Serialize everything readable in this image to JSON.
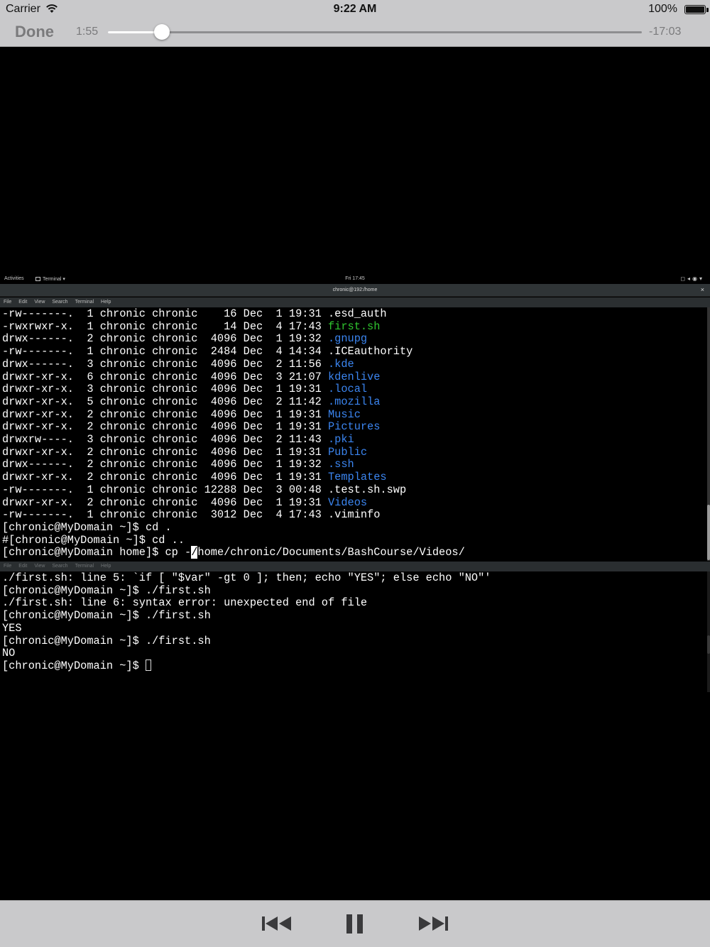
{
  "status_bar": {
    "carrier": "Carrier",
    "time": "9:22 AM",
    "battery": "100%"
  },
  "player": {
    "done_label": "Done",
    "elapsed": "1:55",
    "remaining": "-17:03",
    "progress_fraction": 0.101,
    "controls": [
      "rewind-icon",
      "pause-icon",
      "fast-forward-icon"
    ]
  },
  "desktop": {
    "activities": "Activities",
    "app_menu": "Terminal ▾",
    "clock": "Fri 17:45",
    "window_title": "chronic@192:/home",
    "menu": [
      "File",
      "Edit",
      "View",
      "Search",
      "Terminal",
      "Help"
    ]
  },
  "terminal_top": {
    "lines": [
      {
        "perm": "-rw-------.",
        "links": "1",
        "owner": "chronic",
        "group": "chronic",
        "size": "16",
        "month": "Dec",
        "day": "1",
        "time": "19:31",
        "name": ".esd_auth",
        "type": "file"
      },
      {
        "perm": "-rwxrwxr-x.",
        "links": "1",
        "owner": "chronic",
        "group": "chronic",
        "size": "14",
        "month": "Dec",
        "day": "4",
        "time": "17:43",
        "name": "first.sh",
        "type": "exec"
      },
      {
        "perm": "drwx------.",
        "links": "2",
        "owner": "chronic",
        "group": "chronic",
        "size": "4096",
        "month": "Dec",
        "day": "1",
        "time": "19:32",
        "name": ".gnupg",
        "type": "dir"
      },
      {
        "perm": "-rw-------.",
        "links": "1",
        "owner": "chronic",
        "group": "chronic",
        "size": "2484",
        "month": "Dec",
        "day": "4",
        "time": "14:34",
        "name": ".ICEauthority",
        "type": "file"
      },
      {
        "perm": "drwx------.",
        "links": "3",
        "owner": "chronic",
        "group": "chronic",
        "size": "4096",
        "month": "Dec",
        "day": "2",
        "time": "11:56",
        "name": ".kde",
        "type": "dir"
      },
      {
        "perm": "drwxr-xr-x.",
        "links": "6",
        "owner": "chronic",
        "group": "chronic",
        "size": "4096",
        "month": "Dec",
        "day": "3",
        "time": "21:07",
        "name": "kdenlive",
        "type": "dir"
      },
      {
        "perm": "drwxr-xr-x.",
        "links": "3",
        "owner": "chronic",
        "group": "chronic",
        "size": "4096",
        "month": "Dec",
        "day": "1",
        "time": "19:31",
        "name": ".local",
        "type": "dir"
      },
      {
        "perm": "drwxr-xr-x.",
        "links": "5",
        "owner": "chronic",
        "group": "chronic",
        "size": "4096",
        "month": "Dec",
        "day": "2",
        "time": "11:42",
        "name": ".mozilla",
        "type": "dir"
      },
      {
        "perm": "drwxr-xr-x.",
        "links": "2",
        "owner": "chronic",
        "group": "chronic",
        "size": "4096",
        "month": "Dec",
        "day": "1",
        "time": "19:31",
        "name": "Music",
        "type": "dir"
      },
      {
        "perm": "drwxr-xr-x.",
        "links": "2",
        "owner": "chronic",
        "group": "chronic",
        "size": "4096",
        "month": "Dec",
        "day": "1",
        "time": "19:31",
        "name": "Pictures",
        "type": "dir"
      },
      {
        "perm": "drwxrw----.",
        "links": "3",
        "owner": "chronic",
        "group": "chronic",
        "size": "4096",
        "month": "Dec",
        "day": "2",
        "time": "11:43",
        "name": ".pki",
        "type": "dir"
      },
      {
        "perm": "drwxr-xr-x.",
        "links": "2",
        "owner": "chronic",
        "group": "chronic",
        "size": "4096",
        "month": "Dec",
        "day": "1",
        "time": "19:31",
        "name": "Public",
        "type": "dir"
      },
      {
        "perm": "drwx------.",
        "links": "2",
        "owner": "chronic",
        "group": "chronic",
        "size": "4096",
        "month": "Dec",
        "day": "1",
        "time": "19:32",
        "name": ".ssh",
        "type": "dir"
      },
      {
        "perm": "drwxr-xr-x.",
        "links": "2",
        "owner": "chronic",
        "group": "chronic",
        "size": "4096",
        "month": "Dec",
        "day": "1",
        "time": "19:31",
        "name": "Templates",
        "type": "dir"
      },
      {
        "perm": "-rw-------.",
        "links": "1",
        "owner": "chronic",
        "group": "chronic",
        "size": "12288",
        "month": "Dec",
        "day": "3",
        "time": "00:48",
        "name": ".test.sh.swp",
        "type": "file"
      },
      {
        "perm": "drwxr-xr-x.",
        "links": "2",
        "owner": "chronic",
        "group": "chronic",
        "size": "4096",
        "month": "Dec",
        "day": "1",
        "time": "19:31",
        "name": "Videos",
        "type": "dir"
      },
      {
        "perm": "-rw-------.",
        "links": "1",
        "owner": "chronic",
        "group": "chronic",
        "size": "3012",
        "month": "Dec",
        "day": "4",
        "time": "17:43",
        "name": ".viminfo",
        "type": "file"
      }
    ],
    "cmd1": "[chronic@MyDomain ~]$ cd .",
    "cmd2": "#[chronic@MyDomain ~]$ cd ..",
    "cmd3_prefix": "[chronic@MyDomain home]$ cp -",
    "cmd3_cursor": "/",
    "cmd3_suffix": "home/chronic/Documents/BashCourse/Videos/"
  },
  "terminal_bottom": {
    "lines": [
      "./first.sh: line 5: `if [ \"$var\" -gt 0 ]; then; echo \"YES\"; else echo \"NO\"'",
      "[chronic@MyDomain ~]$ ./first.sh",
      "./first.sh: line 6: syntax error: unexpected end of file",
      "[chronic@MyDomain ~]$ ./first.sh",
      "YES",
      "[chronic@MyDomain ~]$ ./first.sh",
      "NO"
    ],
    "prompt": "[chronic@MyDomain ~]$ "
  }
}
